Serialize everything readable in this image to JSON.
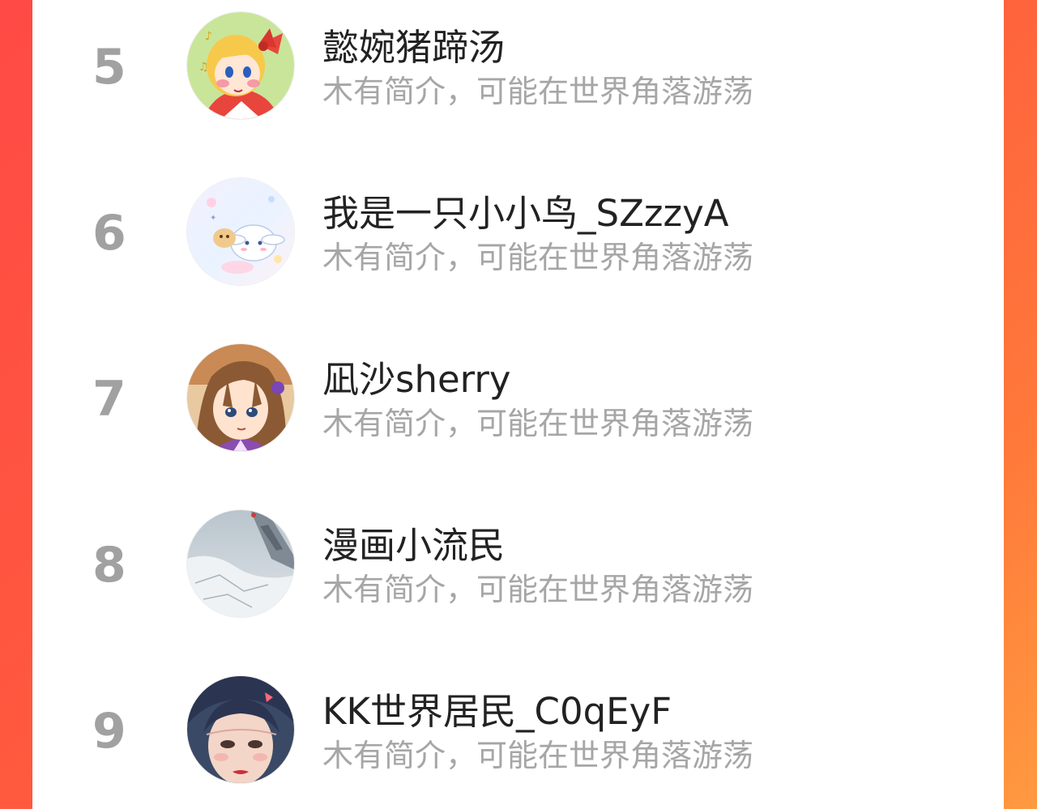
{
  "colors": {
    "background_gradient_start": "#ff4a45",
    "background_gradient_end": "#ff9a40",
    "rank_color": "#a1a1a1",
    "name_color": "#222222",
    "bio_color": "#a6a6a6"
  },
  "ranking": {
    "items": [
      {
        "rank": "5",
        "name": "懿婉猪蹄汤",
        "bio": "木有简介，可能在世界角落游荡",
        "avatar_icon": "sailor-venus-cartoon-avatar"
      },
      {
        "rank": "6",
        "name": "我是一只小小鸟_SZzzyA",
        "bio": "木有简介，可能在世界角落游荡",
        "avatar_icon": "cinnamoroll-cartoon-avatar"
      },
      {
        "rank": "7",
        "name": "凪沙sherry",
        "bio": "木有简介，可能在世界角落游荡",
        "avatar_icon": "anime-girl-avatar"
      },
      {
        "rank": "8",
        "name": "漫画小流民",
        "bio": "木有简介，可能在世界角落游荡",
        "avatar_icon": "airplane-wing-photo-avatar"
      },
      {
        "rank": "9",
        "name": "KK世界居民_C0qEyF",
        "bio": "木有简介，可能在世界角落游荡",
        "avatar_icon": "girl-selfie-avatar"
      }
    ]
  }
}
